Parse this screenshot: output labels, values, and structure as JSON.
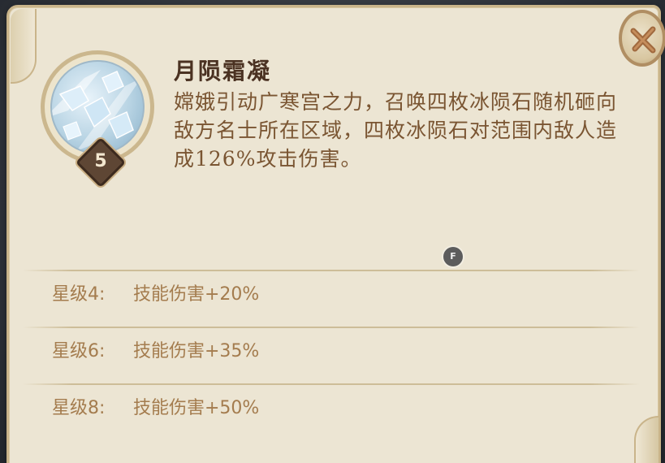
{
  "skill": {
    "name": "月陨霜凝",
    "level": "5",
    "description": "嫦娥引动广寒宫之力，召唤四枚冰陨石随机砸向敌方名士所在区域，四枚冰陨石对范围内敌人造成126%攻击伤害。",
    "icon": "ice-meteor-icon"
  },
  "hint_badge": "F",
  "star_levels": [
    {
      "label": "星级4:",
      "effect": "技能伤害+20%"
    },
    {
      "label": "星级6:",
      "effect": "技能伤害+35%"
    },
    {
      "label": "星级8:",
      "effect": "技能伤害+50%"
    }
  ],
  "colors": {
    "parchment": "#ece5d3",
    "title": "#4b3222",
    "description": "#7a5532",
    "star_text": "#a47c4e",
    "border": "#c9b48a"
  }
}
